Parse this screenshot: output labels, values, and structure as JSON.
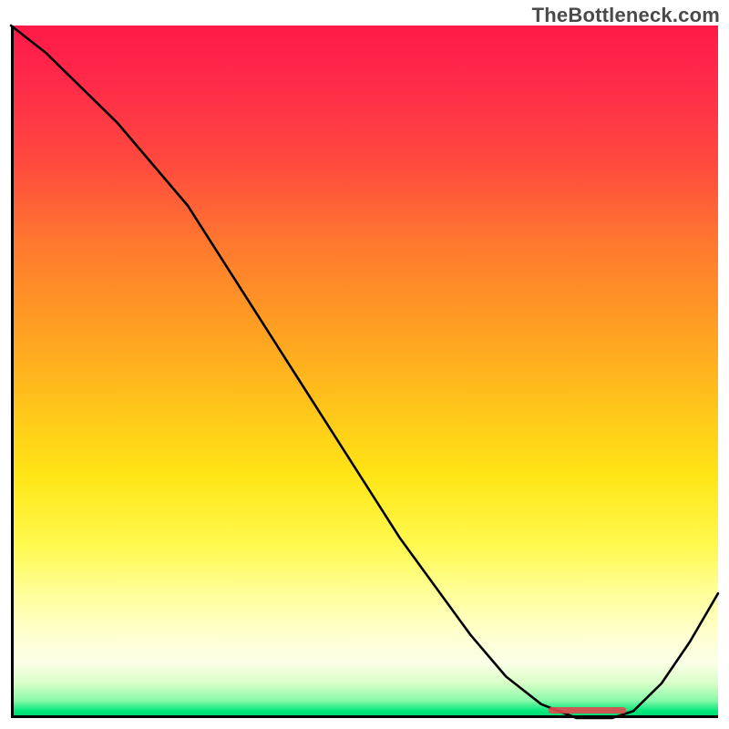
{
  "watermark": "TheBottleneck.com",
  "chart_data": {
    "type": "line",
    "title": "",
    "xlabel": "",
    "ylabel": "",
    "xlim": [
      0,
      100
    ],
    "ylim": [
      0,
      100
    ],
    "background": {
      "kind": "vertical-gradient",
      "stops": [
        {
          "pct": 0,
          "color": "#ff1a47"
        },
        {
          "pct": 8,
          "color": "#ff2a4a"
        },
        {
          "pct": 20,
          "color": "#ff4a3e"
        },
        {
          "pct": 32,
          "color": "#ff7a2e"
        },
        {
          "pct": 44,
          "color": "#ffa022"
        },
        {
          "pct": 56,
          "color": "#ffc81a"
        },
        {
          "pct": 65,
          "color": "#ffe516"
        },
        {
          "pct": 75,
          "color": "#fff94f"
        },
        {
          "pct": 82,
          "color": "#ffff9a"
        },
        {
          "pct": 88,
          "color": "#ffffd0"
        },
        {
          "pct": 92,
          "color": "#fbffe6"
        },
        {
          "pct": 95,
          "color": "#d8ffc8"
        },
        {
          "pct": 97.5,
          "color": "#86f9a8"
        },
        {
          "pct": 99,
          "color": "#00e77a"
        },
        {
          "pct": 100,
          "color": "#00d66a"
        }
      ]
    },
    "series": [
      {
        "name": "bottleneck-curve",
        "x": [
          0,
          5,
          10,
          15,
          20,
          25,
          30,
          35,
          40,
          45,
          50,
          55,
          60,
          65,
          70,
          75,
          80,
          85,
          88,
          92,
          96,
          100
        ],
        "y": [
          100,
          96,
          91,
          86,
          80,
          74,
          66,
          58,
          50,
          42,
          34,
          26,
          19,
          12,
          6,
          2,
          0,
          0,
          1,
          5,
          11,
          18
        ]
      }
    ],
    "annotations": [
      {
        "name": "optimal-range-marker",
        "kind": "h-span",
        "y": 1.2,
        "x0": 76,
        "x1": 87,
        "color": "#e0484f"
      }
    ],
    "grid": false,
    "legend": false
  }
}
